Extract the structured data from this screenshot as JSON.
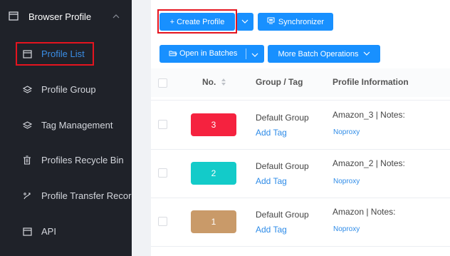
{
  "sidebar": {
    "header": {
      "title": "Browser Profile"
    },
    "items": [
      {
        "label": "Profile List",
        "icon": "window-icon",
        "active": true
      },
      {
        "label": "Profile Group",
        "icon": "layers-icon"
      },
      {
        "label": "Tag Management",
        "icon": "layers-icon"
      },
      {
        "label": "Profiles Recycle Bin",
        "icon": "trash-icon"
      },
      {
        "label": "Profile Transfer Record",
        "icon": "transfer-icon"
      },
      {
        "label": "API",
        "icon": "window-icon"
      }
    ]
  },
  "toolbar": {
    "create_label": "+ Create Profile",
    "sync_label": "Synchronizer",
    "open_batches_label": "Open in Batches",
    "more_batch_label": "More Batch Operations"
  },
  "table": {
    "headers": {
      "no": "No.",
      "group": "Group / Tag",
      "info": "Profile Information"
    },
    "rows": [
      {
        "no": "3",
        "color": "#f5223f",
        "group": "Default Group",
        "tag": "Add Tag",
        "info": "Amazon_3 | Notes:",
        "proxy": "Noproxy"
      },
      {
        "no": "2",
        "color": "#13cbc9",
        "group": "Default Group",
        "tag": "Add Tag",
        "info": "Amazon_2 | Notes:",
        "proxy": "Noproxy"
      },
      {
        "no": "1",
        "color": "#c99a69",
        "group": "Default Group",
        "tag": "Add Tag",
        "info": "Amazon | Notes:",
        "proxy": "Noproxy"
      }
    ]
  },
  "colors": {
    "accent": "#1890ff",
    "highlight": "#e5141f",
    "sidebar_bg": "#1f2229"
  }
}
